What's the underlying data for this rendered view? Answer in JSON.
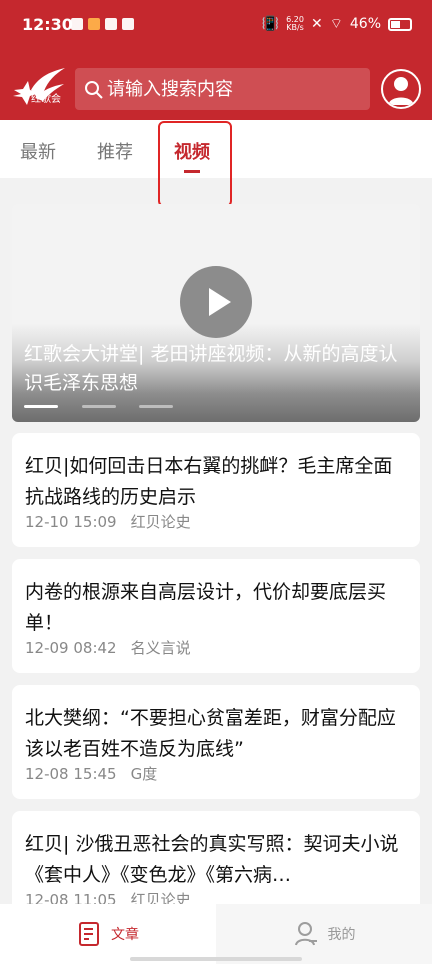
{
  "status_bar": {
    "time": "12:30",
    "net_speed": "6.20",
    "net_unit": "KB/s",
    "battery": "46%"
  },
  "header": {
    "logo_text": "红歌会",
    "search_placeholder": "请输入搜索内容",
    "brand_color": "#c5282e"
  },
  "tabs": [
    {
      "label": "最新"
    },
    {
      "label": "推荐"
    },
    {
      "label": "视频",
      "active": true
    }
  ],
  "video": {
    "title": "红歌会大讲堂| 老田讲座视频：从新的高度认识毛泽东思想"
  },
  "articles": [
    {
      "title": "红贝|如何回击日本右翼的挑衅？毛主席全面抗战路线的历史启示",
      "time": "12-10 15:09",
      "source": "红贝论史"
    },
    {
      "title": "内卷的根源来自高层设计，代价却要底层买单！",
      "time": "12-09 08:42",
      "source": "名义言说"
    },
    {
      "title": "北大樊纲：“不要担心贫富差距，财富分配应该以老百姓不造反为底线”",
      "time": "12-08 15:45",
      "source": "G度"
    },
    {
      "title": "红贝| 沙俄丑恶社会的真实写照：契诃夫小说《套中人》《变色龙》《第六病…",
      "time": "12-08 11:05",
      "source": "红贝论史"
    }
  ],
  "bottom_nav": {
    "articles": "文章",
    "mine": "我的"
  }
}
